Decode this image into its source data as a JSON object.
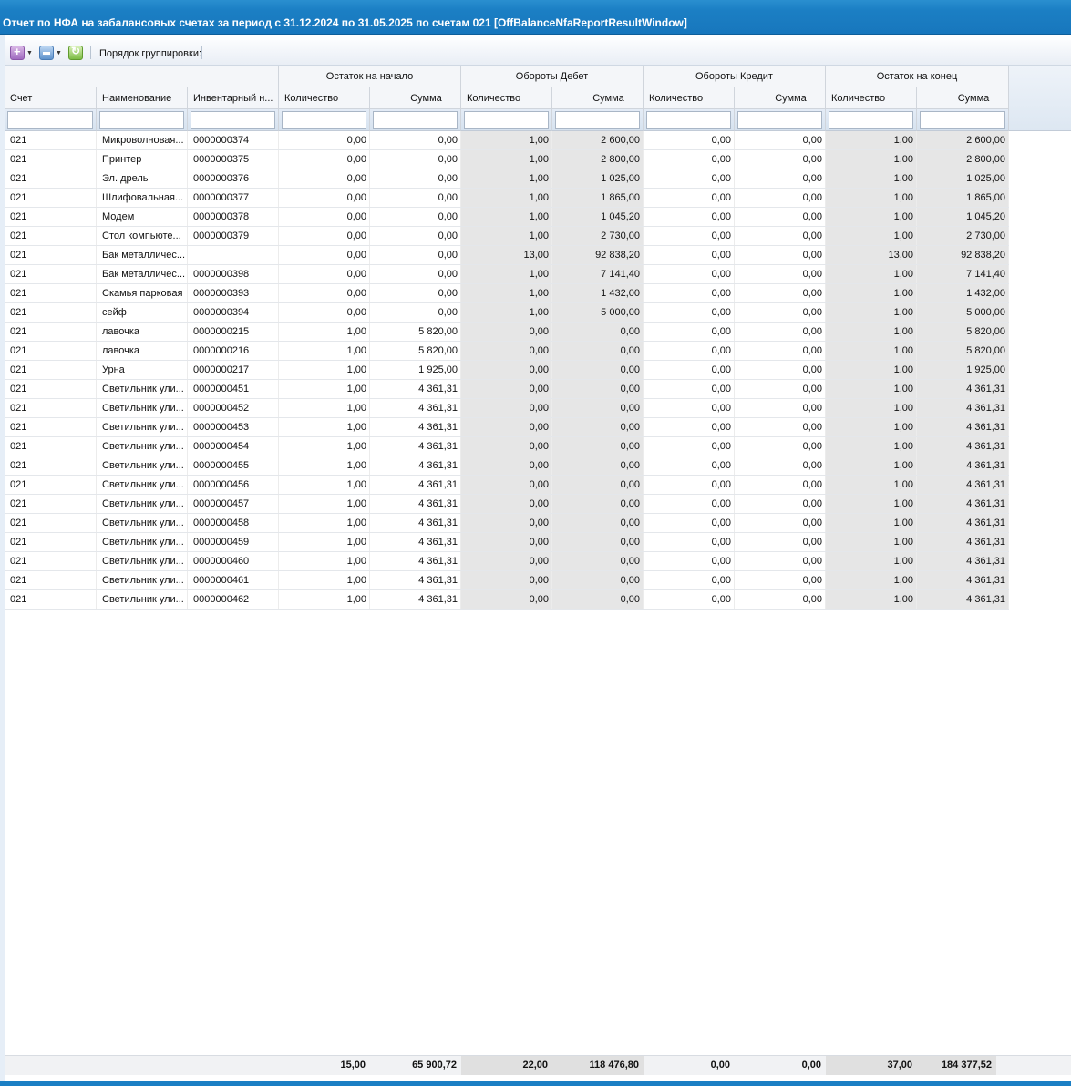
{
  "window": {
    "title": "Отчет по НФА на забалансовых счетах за период с 31.12.2024 по 31.05.2025 по счетам 021 [OffBalanceNfaReportResultWindow]"
  },
  "toolbar": {
    "add_icon": "add-menu-icon",
    "print_icon": "print-icon",
    "refresh_icon": "refresh-icon",
    "grouping_label": "Порядок группировки:"
  },
  "header": {
    "groups": [
      "Остаток на начало",
      "Обороты Дебет",
      "Обороты Кредит",
      "Остаток на конец"
    ],
    "columns": [
      "Счет",
      "Наименование",
      "Инвентарный н...",
      "Количество",
      "Сумма",
      "Количество",
      "Сумма",
      "Количество",
      "Сумма",
      "Количество",
      "Сумма"
    ]
  },
  "rows": [
    [
      "021",
      "Микроволновая...",
      "0000000374",
      "0,00",
      "0,00",
      "1,00",
      "2 600,00",
      "0,00",
      "0,00",
      "1,00",
      "2 600,00"
    ],
    [
      "021",
      "Принтер",
      "0000000375",
      "0,00",
      "0,00",
      "1,00",
      "2 800,00",
      "0,00",
      "0,00",
      "1,00",
      "2 800,00"
    ],
    [
      "021",
      "Эл. дрель",
      "0000000376",
      "0,00",
      "0,00",
      "1,00",
      "1 025,00",
      "0,00",
      "0,00",
      "1,00",
      "1 025,00"
    ],
    [
      "021",
      "Шлифовальная...",
      "0000000377",
      "0,00",
      "0,00",
      "1,00",
      "1 865,00",
      "0,00",
      "0,00",
      "1,00",
      "1 865,00"
    ],
    [
      "021",
      "Модем",
      "0000000378",
      "0,00",
      "0,00",
      "1,00",
      "1 045,20",
      "0,00",
      "0,00",
      "1,00",
      "1 045,20"
    ],
    [
      "021",
      "Стол компьюте...",
      "0000000379",
      "0,00",
      "0,00",
      "1,00",
      "2 730,00",
      "0,00",
      "0,00",
      "1,00",
      "2 730,00"
    ],
    [
      "021",
      "Бак металличес...",
      "",
      "0,00",
      "0,00",
      "13,00",
      "92 838,20",
      "0,00",
      "0,00",
      "13,00",
      "92 838,20"
    ],
    [
      "021",
      "Бак металличес...",
      "0000000398",
      "0,00",
      "0,00",
      "1,00",
      "7 141,40",
      "0,00",
      "0,00",
      "1,00",
      "7 141,40"
    ],
    [
      "021",
      "Скамья парковая",
      "0000000393",
      "0,00",
      "0,00",
      "1,00",
      "1 432,00",
      "0,00",
      "0,00",
      "1,00",
      "1 432,00"
    ],
    [
      "021",
      "сейф",
      "0000000394",
      "0,00",
      "0,00",
      "1,00",
      "5 000,00",
      "0,00",
      "0,00",
      "1,00",
      "5 000,00"
    ],
    [
      "021",
      "лавочка",
      "0000000215",
      "1,00",
      "5 820,00",
      "0,00",
      "0,00",
      "0,00",
      "0,00",
      "1,00",
      "5 820,00"
    ],
    [
      "021",
      "лавочка",
      "0000000216",
      "1,00",
      "5 820,00",
      "0,00",
      "0,00",
      "0,00",
      "0,00",
      "1,00",
      "5 820,00"
    ],
    [
      "021",
      "Урна",
      "0000000217",
      "1,00",
      "1 925,00",
      "0,00",
      "0,00",
      "0,00",
      "0,00",
      "1,00",
      "1 925,00"
    ],
    [
      "021",
      "Светильник ули...",
      "0000000451",
      "1,00",
      "4 361,31",
      "0,00",
      "0,00",
      "0,00",
      "0,00",
      "1,00",
      "4 361,31"
    ],
    [
      "021",
      "Светильник ули...",
      "0000000452",
      "1,00",
      "4 361,31",
      "0,00",
      "0,00",
      "0,00",
      "0,00",
      "1,00",
      "4 361,31"
    ],
    [
      "021",
      "Светильник ули...",
      "0000000453",
      "1,00",
      "4 361,31",
      "0,00",
      "0,00",
      "0,00",
      "0,00",
      "1,00",
      "4 361,31"
    ],
    [
      "021",
      "Светильник ули...",
      "0000000454",
      "1,00",
      "4 361,31",
      "0,00",
      "0,00",
      "0,00",
      "0,00",
      "1,00",
      "4 361,31"
    ],
    [
      "021",
      "Светильник ули...",
      "0000000455",
      "1,00",
      "4 361,31",
      "0,00",
      "0,00",
      "0,00",
      "0,00",
      "1,00",
      "4 361,31"
    ],
    [
      "021",
      "Светильник ули...",
      "0000000456",
      "1,00",
      "4 361,31",
      "0,00",
      "0,00",
      "0,00",
      "0,00",
      "1,00",
      "4 361,31"
    ],
    [
      "021",
      "Светильник ули...",
      "0000000457",
      "1,00",
      "4 361,31",
      "0,00",
      "0,00",
      "0,00",
      "0,00",
      "1,00",
      "4 361,31"
    ],
    [
      "021",
      "Светильник ули...",
      "0000000458",
      "1,00",
      "4 361,31",
      "0,00",
      "0,00",
      "0,00",
      "0,00",
      "1,00",
      "4 361,31"
    ],
    [
      "021",
      "Светильник ули...",
      "0000000459",
      "1,00",
      "4 361,31",
      "0,00",
      "0,00",
      "0,00",
      "0,00",
      "1,00",
      "4 361,31"
    ],
    [
      "021",
      "Светильник ули...",
      "0000000460",
      "1,00",
      "4 361,31",
      "0,00",
      "0,00",
      "0,00",
      "0,00",
      "1,00",
      "4 361,31"
    ],
    [
      "021",
      "Светильник ули...",
      "0000000461",
      "1,00",
      "4 361,31",
      "0,00",
      "0,00",
      "0,00",
      "0,00",
      "1,00",
      "4 361,31"
    ],
    [
      "021",
      "Светильник ули...",
      "0000000462",
      "1,00",
      "4 361,31",
      "0,00",
      "0,00",
      "0,00",
      "0,00",
      "1,00",
      "4 361,31"
    ]
  ],
  "totals": [
    "15,00",
    "65 900,72",
    "22,00",
    "118 476,80",
    "0,00",
    "0,00",
    "37,00",
    "184 377,52"
  ],
  "colors": {
    "title_bar": "#1b7fc4",
    "shaded_column": "#e6e6e6"
  }
}
